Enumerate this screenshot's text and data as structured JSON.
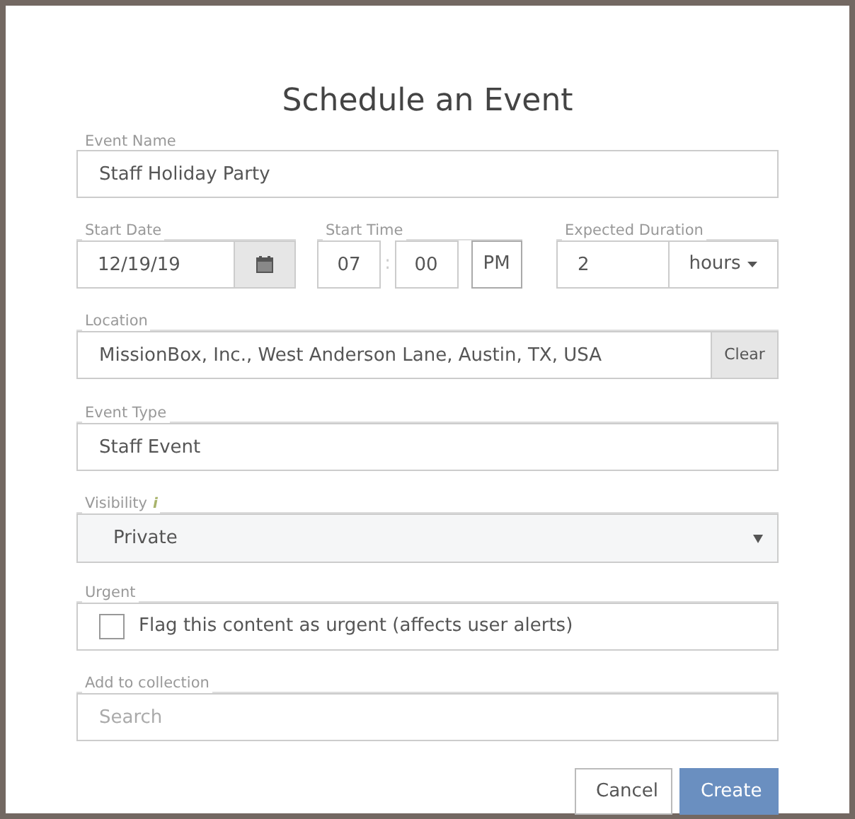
{
  "dialog": {
    "title": "Schedule an Event"
  },
  "event_name": {
    "label": "Event Name",
    "value": "Staff Holiday Party"
  },
  "start_date": {
    "label": "Start Date",
    "value": "12/19/19"
  },
  "start_time": {
    "label": "Start Time",
    "hour": "07",
    "separator": ":",
    "minute": "00",
    "meridiem": "PM"
  },
  "expected_duration": {
    "label": "Expected Duration",
    "value": "2",
    "unit": "hours"
  },
  "location": {
    "label": "Location",
    "value": "MissionBox, Inc., West Anderson Lane, Austin, TX, USA",
    "clear_button": "Clear"
  },
  "event_type": {
    "label": "Event Type",
    "value": "Staff Event"
  },
  "visibility": {
    "label": "Visibility",
    "info": "i",
    "value": "Private"
  },
  "urgent": {
    "label": "Urgent",
    "checkbox_label": "Flag this content as urgent (affects user alerts)",
    "checked": false
  },
  "collection": {
    "label": "Add to collection",
    "placeholder": "Search"
  },
  "buttons": [
    {
      "label": "Cancel",
      "kind": "secondary"
    },
    {
      "label": "Create",
      "kind": "primary"
    }
  ]
}
